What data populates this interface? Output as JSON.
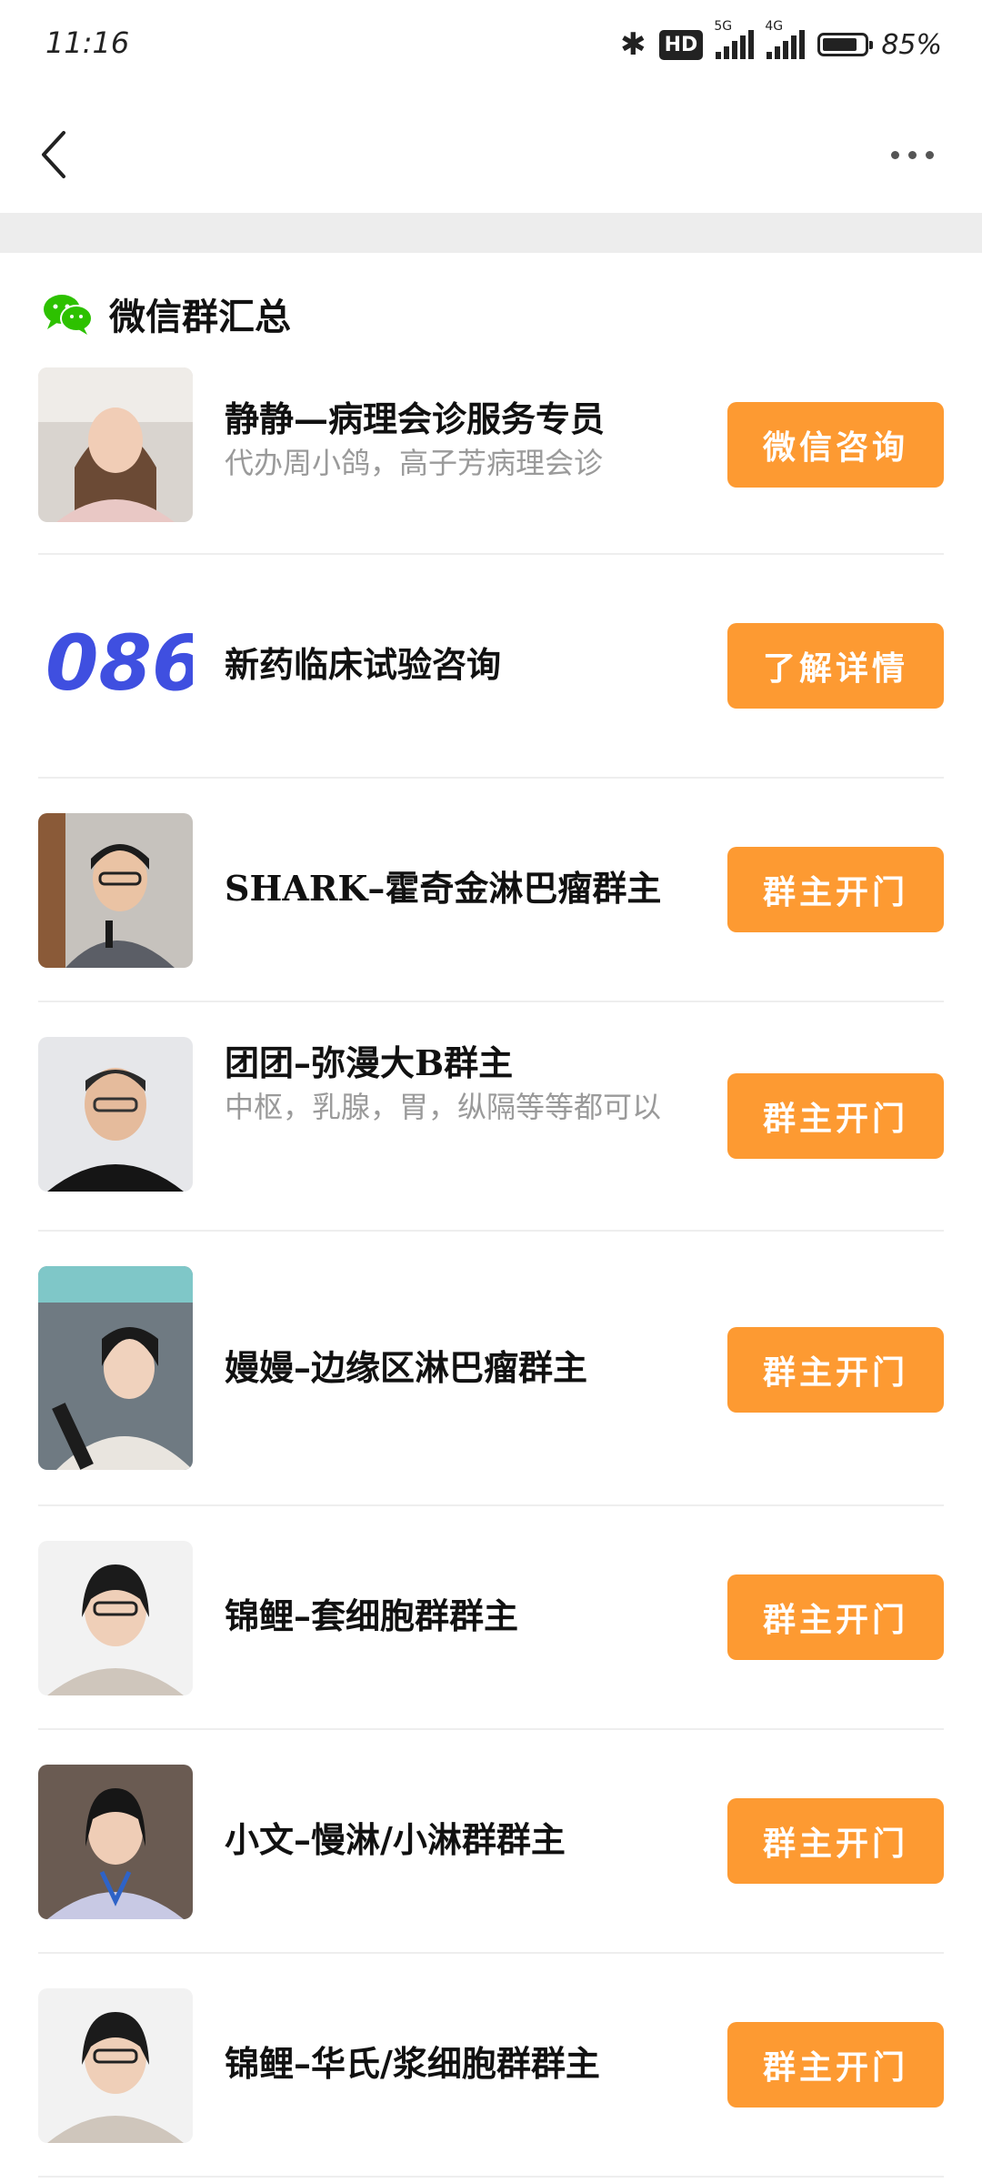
{
  "status": {
    "time": "11:16",
    "hd_label": "HD",
    "net1": "5G",
    "net2": "4G",
    "battery_level": 0.85,
    "battery_text": "85%"
  },
  "nav": {
    "back_icon": "chevron-left-icon",
    "more_icon": "more-horizontal-icon"
  },
  "section": {
    "icon": "wechat-icon",
    "title": "微信群汇总"
  },
  "accent_color": "#fd9a32",
  "items": [
    {
      "title": "静静—病理会诊服务专员",
      "subtitle": "代办周小鸽，高子芳病理会诊",
      "button": "微信咨询",
      "avatar": "photo-woman-long-hair"
    },
    {
      "title": "新药临床试验咨询",
      "subtitle": "",
      "button": "了解详情",
      "avatar_text": "086"
    },
    {
      "title": "SHARK–霍奇金淋巴瘤群主",
      "subtitle": "",
      "button": "群主开门",
      "avatar": "photo-man-glasses-microphone"
    },
    {
      "title": "团团–弥漫大B群主",
      "subtitle": "中枢，乳腺，胃，纵隔等等都可以",
      "button": "群主开门",
      "avatar": "photo-man-glasses-black-shirt"
    },
    {
      "title": "嫚嫚–边缘区淋巴瘤群主",
      "subtitle": "",
      "button": "群主开门",
      "avatar": "photo-woman-in-car"
    },
    {
      "title": "锦鲤–套细胞群群主",
      "subtitle": "",
      "button": "群主开门",
      "avatar": "photo-woman-glasses-short-hair"
    },
    {
      "title": "小文–慢淋/小淋群群主",
      "subtitle": "",
      "button": "群主开门",
      "avatar": "photo-woman-lanyard"
    },
    {
      "title": "锦鲤–华氏/浆细胞群群主",
      "subtitle": "",
      "button": "群主开门",
      "avatar": "photo-woman-glasses-short-hair"
    }
  ]
}
